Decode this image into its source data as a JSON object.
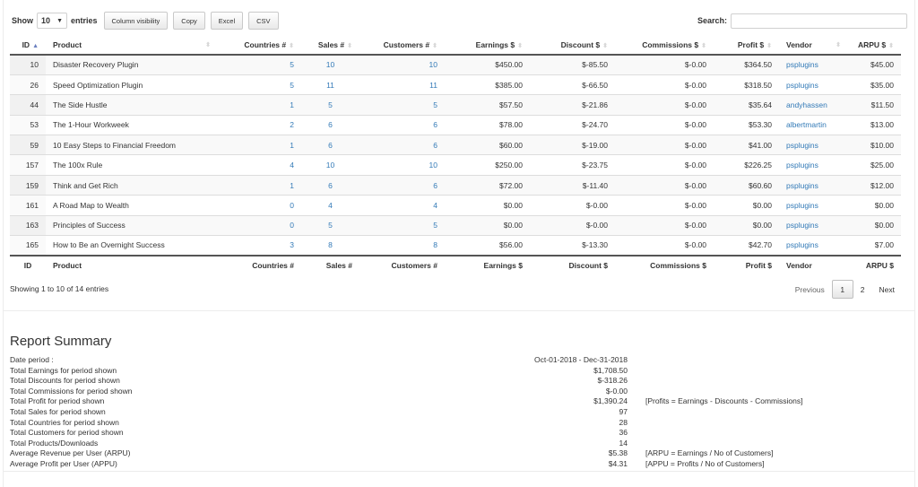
{
  "toolbar": {
    "show_label": "Show",
    "length_value": "10",
    "entries_label": "entries",
    "buttons": [
      "Column visibility",
      "Copy",
      "Excel",
      "CSV"
    ],
    "search_label": "Search:",
    "search_value": ""
  },
  "table": {
    "columns": [
      "ID",
      "Product",
      "Countries #",
      "Sales #",
      "Customers #",
      "Earnings $",
      "Discount $",
      "Commissions $",
      "Profit $",
      "Vendor",
      "ARPU $"
    ],
    "sorted_column": "ID",
    "sort_direction": "asc",
    "rows": [
      {
        "id": "10",
        "product": "Disaster Recovery Plugin",
        "countries": "5",
        "sales": "10",
        "customers": "10",
        "earnings": "$450.00",
        "discount": "$-85.50",
        "commissions": "$-0.00",
        "profit": "$364.50",
        "vendor": "psplugins",
        "arpu": "$45.00"
      },
      {
        "id": "26",
        "product": "Speed Optimization Plugin",
        "countries": "5",
        "sales": "11",
        "customers": "11",
        "earnings": "$385.00",
        "discount": "$-66.50",
        "commissions": "$-0.00",
        "profit": "$318.50",
        "vendor": "psplugins",
        "arpu": "$35.00"
      },
      {
        "id": "44",
        "product": "The Side Hustle",
        "countries": "1",
        "sales": "5",
        "customers": "5",
        "earnings": "$57.50",
        "discount": "$-21.86",
        "commissions": "$-0.00",
        "profit": "$35.64",
        "vendor": "andyhassen",
        "arpu": "$11.50"
      },
      {
        "id": "53",
        "product": "The 1-Hour Workweek",
        "countries": "2",
        "sales": "6",
        "customers": "6",
        "earnings": "$78.00",
        "discount": "$-24.70",
        "commissions": "$-0.00",
        "profit": "$53.30",
        "vendor": "albertmartin",
        "arpu": "$13.00"
      },
      {
        "id": "59",
        "product": "10 Easy Steps to Financial Freedom",
        "countries": "1",
        "sales": "6",
        "customers": "6",
        "earnings": "$60.00",
        "discount": "$-19.00",
        "commissions": "$-0.00",
        "profit": "$41.00",
        "vendor": "psplugins",
        "arpu": "$10.00"
      },
      {
        "id": "157",
        "product": "The 100x Rule",
        "countries": "4",
        "sales": "10",
        "customers": "10",
        "earnings": "$250.00",
        "discount": "$-23.75",
        "commissions": "$-0.00",
        "profit": "$226.25",
        "vendor": "psplugins",
        "arpu": "$25.00"
      },
      {
        "id": "159",
        "product": "Think and Get Rich",
        "countries": "1",
        "sales": "6",
        "customers": "6",
        "earnings": "$72.00",
        "discount": "$-11.40",
        "commissions": "$-0.00",
        "profit": "$60.60",
        "vendor": "psplugins",
        "arpu": "$12.00"
      },
      {
        "id": "161",
        "product": "A Road Map to Wealth",
        "countries": "0",
        "sales": "4",
        "customers": "4",
        "earnings": "$0.00",
        "discount": "$-0.00",
        "commissions": "$-0.00",
        "profit": "$0.00",
        "vendor": "psplugins",
        "arpu": "$0.00"
      },
      {
        "id": "163",
        "product": "Principles of Success",
        "countries": "0",
        "sales": "5",
        "customers": "5",
        "earnings": "$0.00",
        "discount": "$-0.00",
        "commissions": "$-0.00",
        "profit": "$0.00",
        "vendor": "psplugins",
        "arpu": "$0.00"
      },
      {
        "id": "165",
        "product": "How to Be an Overnight Success",
        "countries": "3",
        "sales": "8",
        "customers": "8",
        "earnings": "$56.00",
        "discount": "$-13.30",
        "commissions": "$-0.00",
        "profit": "$42.70",
        "vendor": "psplugins",
        "arpu": "$7.00"
      }
    ]
  },
  "footer": {
    "info": "Showing 1 to 10 of 14 entries",
    "pagination": {
      "previous": "Previous",
      "pages": [
        "1",
        "2"
      ],
      "current": "1",
      "next": "Next"
    }
  },
  "summary": {
    "title": "Report Summary",
    "rows": [
      {
        "label": "Date period :",
        "value": "Oct-01-2018 - Dec-31-2018",
        "note": ""
      },
      {
        "label": "Total Earnings for period shown",
        "value": "$1,708.50",
        "note": ""
      },
      {
        "label": "Total Discounts for period shown",
        "value": "$-318.26",
        "note": ""
      },
      {
        "label": "Total Commissions for period shown",
        "value": "$-0.00",
        "note": ""
      },
      {
        "label": "Total Profit for period shown",
        "value": "$1,390.24",
        "note": "[Profits = Earnings - Discounts - Commissions]"
      },
      {
        "label": "Total Sales for period shown",
        "value": "97",
        "note": ""
      },
      {
        "label": "Total Countries for period shown",
        "value": "28",
        "note": ""
      },
      {
        "label": "Total Customers for period shown",
        "value": "36",
        "note": ""
      },
      {
        "label": "Total Products/Downloads",
        "value": "14",
        "note": ""
      },
      {
        "label": "Average Revenue per User (ARPU)",
        "value": "$5.38",
        "note": "[ARPU = Earnings / No of Customers]"
      },
      {
        "label": "Average Profit per User (APPU)",
        "value": "$4.31",
        "note": "[APPU = Profits / No of Customers]"
      }
    ]
  },
  "colors": {
    "link": "#337ab7",
    "stripe": "#f9f9f9",
    "header_border": "#555555"
  }
}
